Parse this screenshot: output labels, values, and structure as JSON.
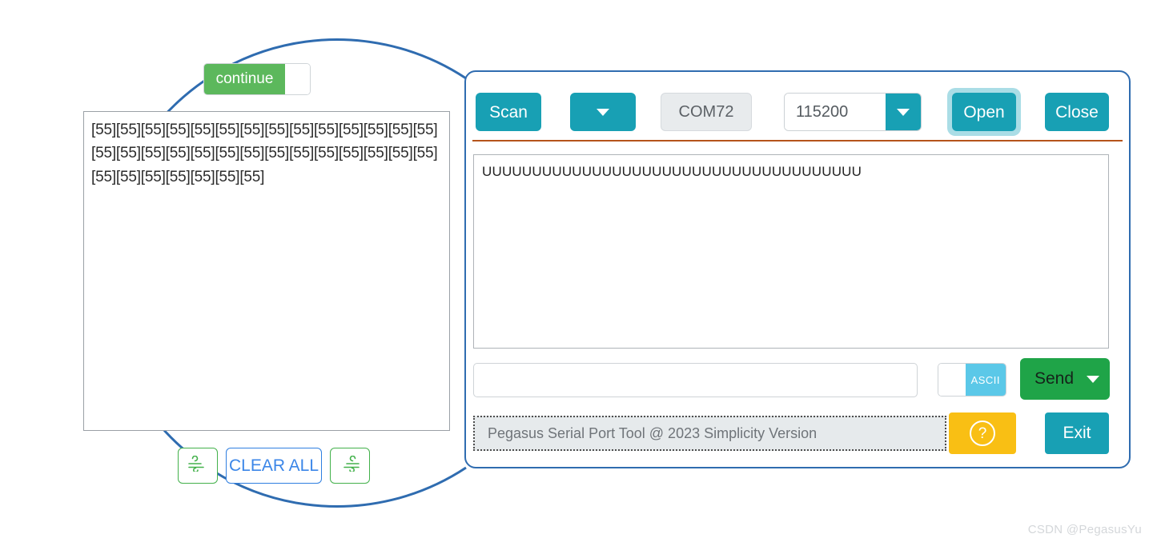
{
  "app": {
    "status_text": "Pegasus Serial Port Tool @ 2023 Simplicity Version",
    "watermark": "CSDN @PegasusYu"
  },
  "toolbar": {
    "scan_label": "Scan",
    "port_dropdown_icon": "chevron-down-icon",
    "port_value": "COM72",
    "baud_value": "115200",
    "baud_dropdown_icon": "chevron-down-icon",
    "open_label": "Open",
    "close_label": "Close"
  },
  "receive": {
    "text": "UUUUUUUUUUUUUUUUUUUUUUUUUUUUUUUUUUUUUU"
  },
  "send": {
    "input_value": "",
    "input_placeholder": "",
    "format_toggle_label": "ASCII",
    "send_label": "Send",
    "send_dropdown_icon": "chevron-down-icon"
  },
  "actions": {
    "help_icon": "question-circle-icon",
    "exit_label": "Exit"
  },
  "magnified": {
    "continue_toggle_label": "continue",
    "log_text": "[55][55][55][55][55][55][55][55][55][55][55][55][55][55][55][55][55][55][55][55][55][55][55][55][55][55][55][55][55][55][55][55][55][55][55]",
    "clear_all_label": "CLEAR ALL",
    "wind_left_icon": "wind-left-icon",
    "wind_right_icon": "wind-right-icon"
  },
  "colors": {
    "teal": "#18A0B4",
    "green": "#1FA448",
    "toggle_green": "#5CB85C",
    "ascii_blue": "#5BC8E8",
    "amber": "#F9BF14",
    "circle_blue": "#2f6cb0",
    "divider_orange": "#b5541b"
  }
}
